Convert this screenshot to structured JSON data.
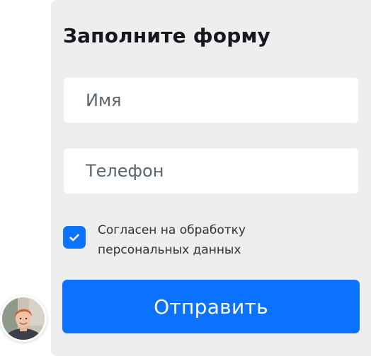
{
  "form": {
    "title": "Заполните форму",
    "name_field": {
      "placeholder": "Имя",
      "value": ""
    },
    "phone_field": {
      "placeholder": "Телефон",
      "value": ""
    },
    "consent": {
      "checked": true,
      "label_line1": "Согласен на обработку",
      "label_line2": "персональных данных"
    },
    "submit_label": "Отправить"
  },
  "avatar": {
    "icon": "person-photo"
  },
  "colors": {
    "panel_bg": "#eeeeee",
    "accent": "#0a72ff",
    "field_bg": "#ffffff",
    "title_text": "#16171f",
    "placeholder_text": "#5b6470"
  }
}
